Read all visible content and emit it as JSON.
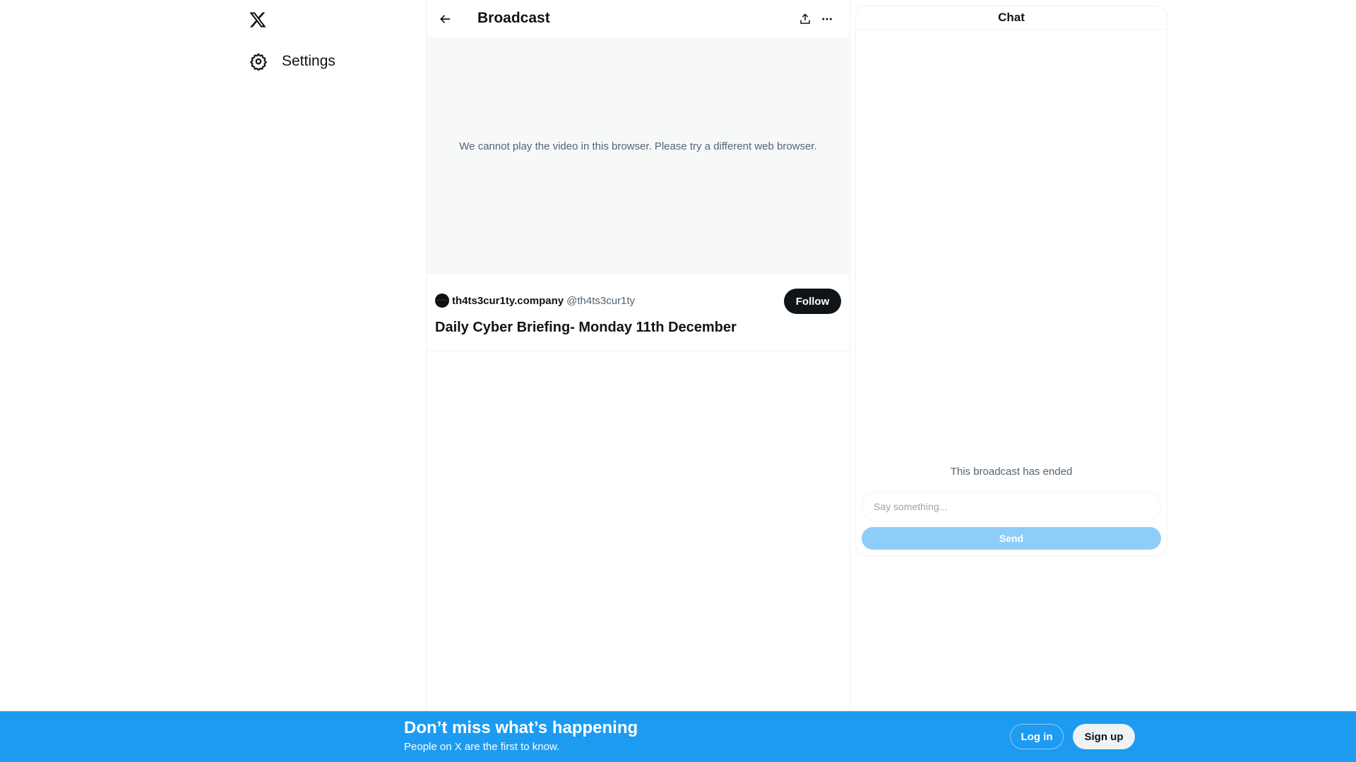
{
  "sidebar": {
    "logo_icon": "x-logo-icon",
    "items": [
      {
        "label": "Settings",
        "icon": "gear-icon"
      }
    ]
  },
  "header": {
    "back_icon": "arrow-left-icon",
    "title": "Broadcast",
    "share_icon": "share-icon",
    "more_icon": "more-horizontal-icon"
  },
  "video": {
    "message": "We cannot play the video in this browser. Please try a different web browser."
  },
  "broadcast": {
    "author_name": "th4ts3cur1ty.company",
    "author_handle": "@th4ts3cur1ty",
    "follow_label": "Follow",
    "title": "Daily Cyber Briefing- Monday 11th December"
  },
  "chat": {
    "title": "Chat",
    "status": "This broadcast has ended",
    "input_placeholder": "Say something...",
    "input_value": "",
    "send_label": "Send"
  },
  "banner": {
    "title": "Don’t miss what’s happening",
    "subtitle": "People on X are the first to know.",
    "login_label": "Log in",
    "signup_label": "Sign up"
  },
  "colors": {
    "brand_blue": "#1d9bf0",
    "send_disabled": "#8ecdf7",
    "text_primary": "#0f1419",
    "text_secondary": "#536471"
  }
}
